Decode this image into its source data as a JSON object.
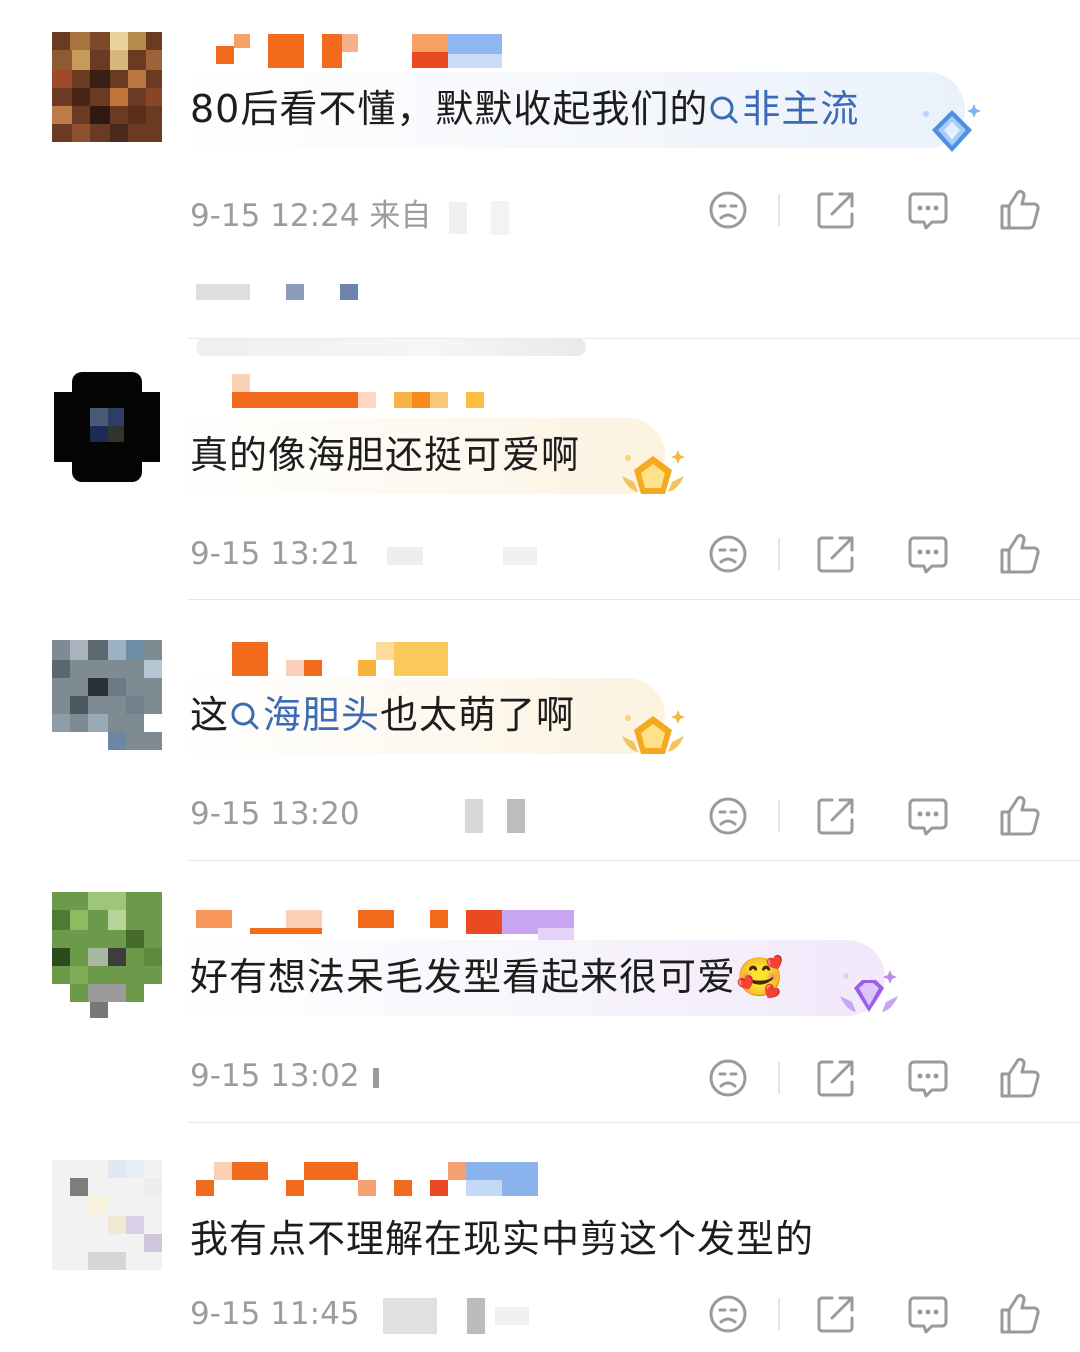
{
  "comments": [
    {
      "text_before": "80后看不懂，默默收起我们的",
      "topic": "非主流",
      "text_after": "",
      "time": "9-15 12:24",
      "source_prefix": "来自",
      "badge": "diamond-badge-blue"
    },
    {
      "text_before": "真的像海胆还挺可爱啊",
      "topic": "",
      "text_after": "",
      "time": "9-15 13:21",
      "source_prefix": "",
      "badge": "pentagon-badge-gold"
    },
    {
      "text_before": "这",
      "topic": "海胆头",
      "text_after": "也太萌了啊",
      "time": "9-15 13:20",
      "source_prefix": "",
      "badge": "pentagon-badge-gold"
    },
    {
      "text_before": "好有想法呆毛发型看起来很可爱",
      "topic": "",
      "text_after": "🥰",
      "time": "9-15 13:02",
      "source_prefix": "",
      "badge": "diamond-badge-purple"
    },
    {
      "text_before": "我有点不理解在现实中剪这个发型的",
      "topic": "",
      "text_after": "",
      "time": "9-15 11:45",
      "source_prefix": "",
      "badge": ""
    }
  ],
  "icons": {
    "dislike": "sad-face-icon",
    "share": "share-icon",
    "comment": "comment-bubble-icon",
    "like": "thumbs-up-icon"
  },
  "colors": {
    "topic_link": "#3b6bb5",
    "meta_text": "#9c9c9c",
    "username_orange": "#f26a1b",
    "icon_stroke": "#9a9a9a"
  }
}
